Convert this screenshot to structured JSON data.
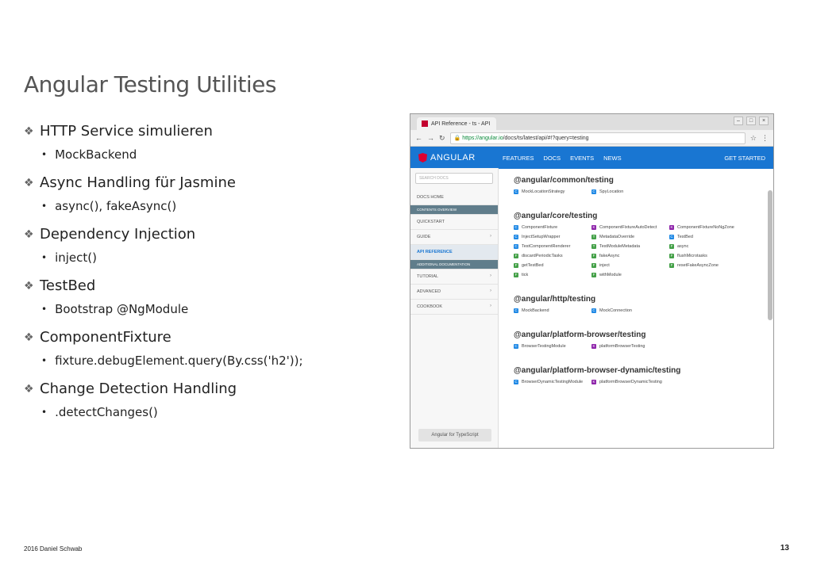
{
  "slide": {
    "title": "Angular Testing Utilities",
    "bullets": [
      {
        "main": "HTTP Service simulieren",
        "sub": "MockBackend"
      },
      {
        "main": "Async Handling für Jasmine",
        "sub": "async(), fakeAsync()"
      },
      {
        "main": "Dependency Injection",
        "sub": "inject()"
      },
      {
        "main": "TestBed",
        "sub": "Bootstrap @NgModule"
      },
      {
        "main": "ComponentFixture",
        "sub": "fixture.debugElement.query(By.css('h2'));"
      },
      {
        "main": "Change Detection Handling",
        "sub": ".detectChanges()"
      }
    ],
    "footer_left": "2016 Daniel Schwab",
    "page_number": "13"
  },
  "browser": {
    "tab_title": "API Reference - ts - API",
    "url_host": "https://angular.io",
    "url_path": "/docs/ts/latest/api/#!?query=testing",
    "logo": "ANGULAR",
    "nav": [
      "FEATURES",
      "DOCS",
      "EVENTS",
      "NEWS"
    ],
    "get_started": "GET STARTED",
    "search_placeholder": "SEARCH DOCS",
    "sidebar": [
      "DOCS HOME",
      "CONTENTS OVERVIEW",
      "QUICKSTART",
      "GUIDE",
      "API REFERENCE",
      "ADDITIONAL DOCUMENTATION",
      "TUTORIAL",
      "ADVANCED",
      "COOKBOOK"
    ],
    "ts_button": "Angular for TypeScript",
    "colors": {
      "class": "#1e88e5",
      "function": "#43a047",
      "type": "#8e24aa",
      "brand": "#dd0031",
      "nav": "#1976d2"
    },
    "sections": [
      {
        "title": "@angular/common/testing",
        "items": [
          {
            "badge": "C",
            "kind": "class",
            "label": "MockLocationStrategy"
          },
          {
            "badge": "C",
            "kind": "class",
            "label": "SpyLocation"
          }
        ]
      },
      {
        "title": "@angular/core/testing",
        "items": [
          {
            "badge": "C",
            "kind": "class",
            "label": "ComponentFixture"
          },
          {
            "badge": "K",
            "kind": "type",
            "label": "ComponentFixtureAutoDetect"
          },
          {
            "badge": "K",
            "kind": "type",
            "label": "ComponentFixtureNoNgZone"
          },
          {
            "badge": "C",
            "kind": "class",
            "label": "InjectSetupWrapper"
          },
          {
            "badge": "T",
            "kind": "function",
            "label": "MetadataOverride"
          },
          {
            "badge": "C",
            "kind": "class",
            "label": "TestBed"
          },
          {
            "badge": "C",
            "kind": "class",
            "label": "TestComponentRenderer"
          },
          {
            "badge": "T",
            "kind": "function",
            "label": "TestModuleMetadata"
          },
          {
            "badge": "F",
            "kind": "function",
            "label": "async"
          },
          {
            "badge": "F",
            "kind": "function",
            "label": "discardPeriodicTasks"
          },
          {
            "badge": "F",
            "kind": "function",
            "label": "fakeAsync"
          },
          {
            "badge": "F",
            "kind": "function",
            "label": "flushMicrotasks"
          },
          {
            "badge": "F",
            "kind": "function",
            "label": "getTestBed"
          },
          {
            "badge": "F",
            "kind": "function",
            "label": "inject"
          },
          {
            "badge": "F",
            "kind": "function",
            "label": "resetFakeAsyncZone"
          },
          {
            "badge": "F",
            "kind": "function",
            "label": "tick"
          },
          {
            "badge": "F",
            "kind": "function",
            "label": "withModule"
          }
        ]
      },
      {
        "title": "@angular/http/testing",
        "items": [
          {
            "badge": "C",
            "kind": "class",
            "label": "MockBackend"
          },
          {
            "badge": "C",
            "kind": "class",
            "label": "MockConnection"
          }
        ]
      },
      {
        "title": "@angular/platform-browser/testing",
        "items": [
          {
            "badge": "C",
            "kind": "class",
            "label": "BrowserTestingModule"
          },
          {
            "badge": "K",
            "kind": "type",
            "label": "platformBrowserTesting"
          }
        ]
      },
      {
        "title": "@angular/platform-browser-dynamic/testing",
        "items": [
          {
            "badge": "C",
            "kind": "class",
            "label": "BrowserDynamicTestingModule"
          },
          {
            "badge": "K",
            "kind": "type",
            "label": "platformBrowserDynamicTesting"
          }
        ]
      }
    ]
  }
}
